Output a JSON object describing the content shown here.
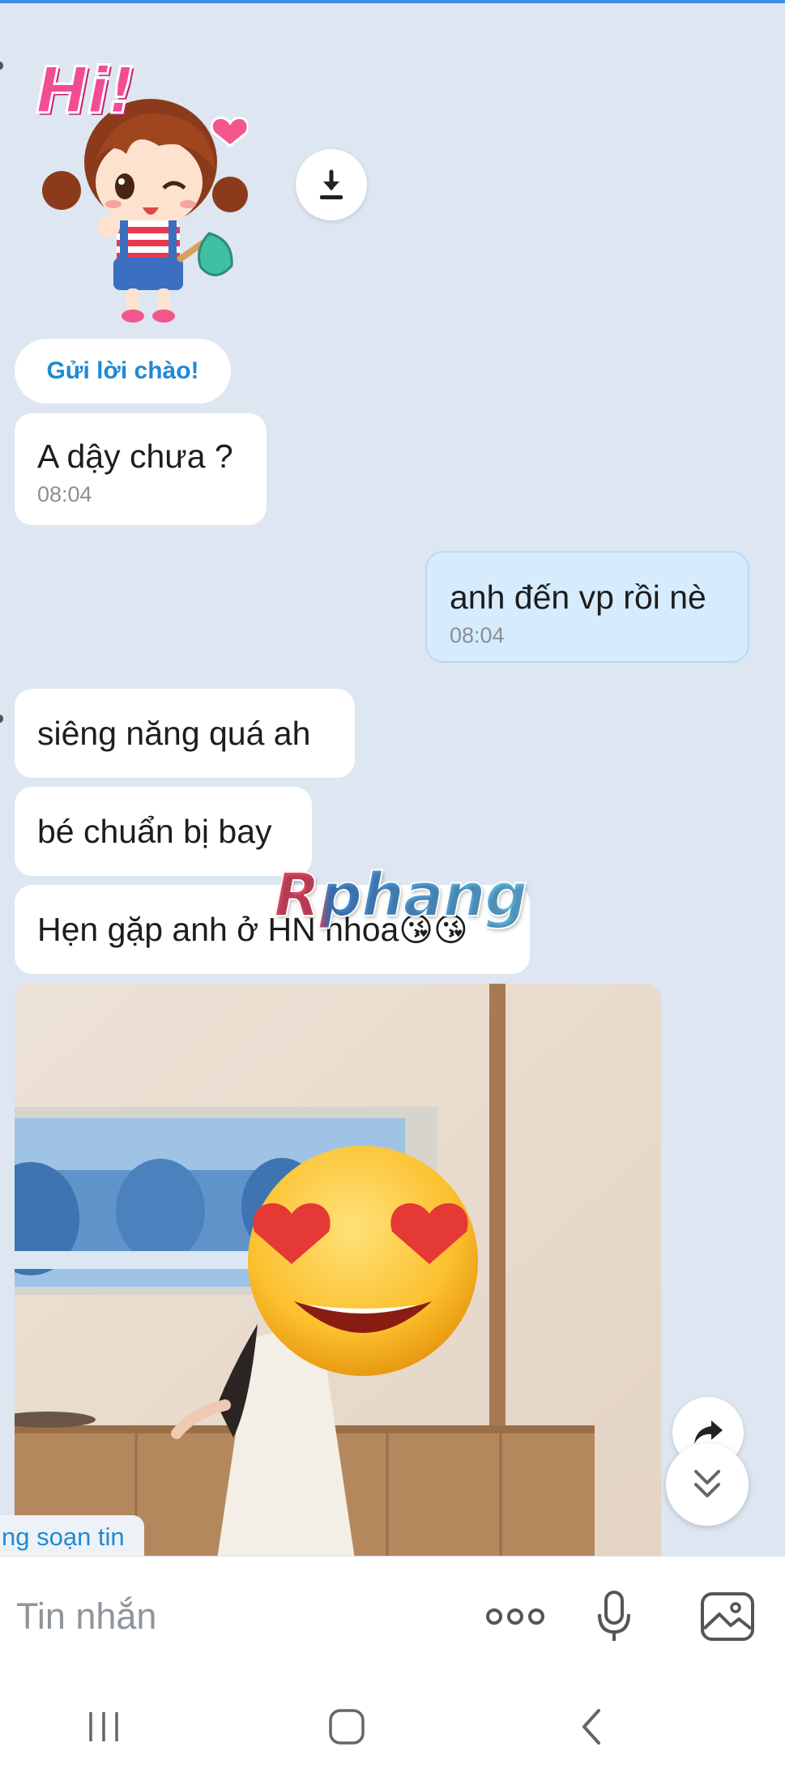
{
  "conversation": {
    "sticker": {
      "text": "Hi!"
    },
    "greeting_button": "Gửi lời chào!",
    "messages": [
      {
        "direction": "in",
        "text": "A dậy chưa ?",
        "time": "08:04"
      },
      {
        "direction": "out",
        "text": "anh đến vp rồi nè",
        "time": "08:04"
      },
      {
        "direction": "in",
        "text": "siêng năng quá ah"
      },
      {
        "direction": "in",
        "text": "bé chuẩn bị bay"
      },
      {
        "direction": "in",
        "text": "Hẹn gặp anh ở HN nhoa😘😘"
      }
    ],
    "photo": {
      "overlay_emoji": "😍"
    },
    "watermark": "Rphang",
    "typing_indicator": "ng soạn tin"
  },
  "composer": {
    "placeholder": "Tin nhắn",
    "icons": [
      "more-icon",
      "microphone-icon",
      "image-icon"
    ]
  },
  "system_nav": {
    "icons": [
      "recent-apps-icon",
      "home-icon",
      "back-icon"
    ]
  },
  "colors": {
    "background": "#dde6f1",
    "incoming_bubble": "#ffffff",
    "outgoing_bubble": "#d6ecfd",
    "accent": "#1f8ad6",
    "timestamp": "#8b8f95"
  }
}
